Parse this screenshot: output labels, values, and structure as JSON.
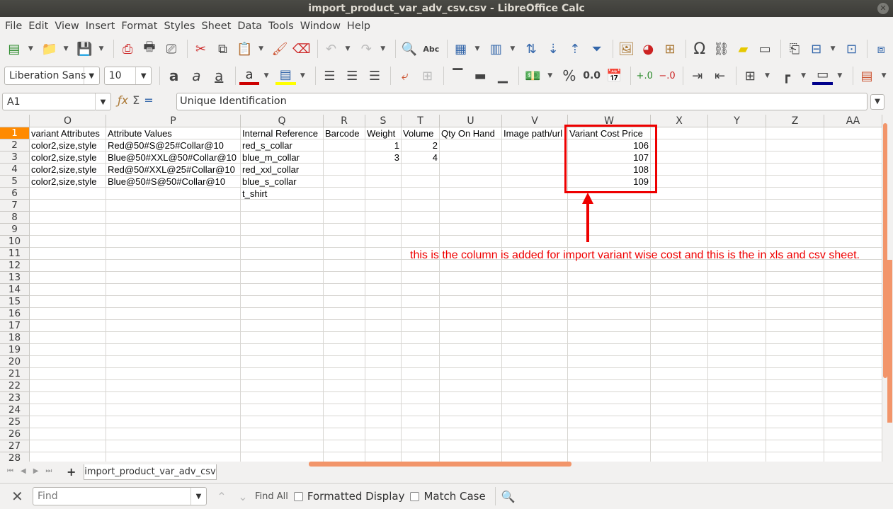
{
  "window": {
    "title": "import_product_var_adv_csv.csv - LibreOffice Calc"
  },
  "menu": [
    "File",
    "Edit",
    "View",
    "Insert",
    "Format",
    "Styles",
    "Sheet",
    "Data",
    "Tools",
    "Window",
    "Help"
  ],
  "format_toolbar": {
    "font_name": "Liberation Sans",
    "font_size": "10",
    "percent_label": "%",
    "decimal_label": "0.0"
  },
  "formula_bar": {
    "name_box": "A1",
    "content": "Unique Identification"
  },
  "columns": [
    "O",
    "P",
    "Q",
    "R",
    "S",
    "T",
    "U",
    "V",
    "W",
    "X",
    "Y",
    "Z",
    "AA"
  ],
  "row_numbers": [
    "1",
    "2",
    "3",
    "4",
    "5",
    "6",
    "7",
    "8",
    "9",
    "10",
    "11",
    "12",
    "13",
    "14",
    "15",
    "16",
    "17",
    "18",
    "19",
    "20",
    "21",
    "22",
    "23",
    "24",
    "25",
    "26",
    "27",
    "28"
  ],
  "rows": [
    [
      "variant Attributes",
      "Attribute Values",
      "Internal Reference",
      "Barcode",
      "Weight",
      "Volume",
      "Qty On Hand",
      "Image path/url",
      "Variant Cost Price",
      "",
      "",
      "",
      ""
    ],
    [
      "color2,size,style",
      "Red@50#S@25#Collar@10",
      "red_s_collar",
      "",
      "1",
      "2",
      "",
      "",
      "106",
      "",
      "",
      "",
      ""
    ],
    [
      "color2,size,style",
      "Blue@50#XXL@50#Collar@10",
      "blue_m_collar",
      "",
      "3",
      "4",
      "",
      "",
      "107",
      "",
      "",
      "",
      ""
    ],
    [
      "color2,size,style",
      "Red@50#XXL@25#Collar@10",
      "red_xxl_collar",
      "",
      "",
      "",
      "",
      "",
      "108",
      "",
      "",
      "",
      ""
    ],
    [
      "color2,size,style",
      "Blue@50#S@50#Collar@10",
      "blue_s_collar",
      "",
      "",
      "",
      "",
      "",
      "109",
      "",
      "",
      "",
      ""
    ],
    [
      "",
      "",
      "t_shirt",
      "",
      "",
      "",
      "",
      "",
      "",
      "",
      "",
      "",
      ""
    ]
  ],
  "annotation": {
    "text": "this is the column is added for import variant wise cost and this is the in xls and csv sheet.",
    "color": "#ee0000"
  },
  "sheet_tab": {
    "name": "import_product_var_adv_csv"
  },
  "find_bar": {
    "placeholder": "Find",
    "find_all": "Find All",
    "formatted_display": "Formatted Display",
    "match_case": "Match Case"
  },
  "colors": {
    "accent": "#ff8a00",
    "scrollbar": "#f2956a",
    "annotation": "#ee0000"
  }
}
